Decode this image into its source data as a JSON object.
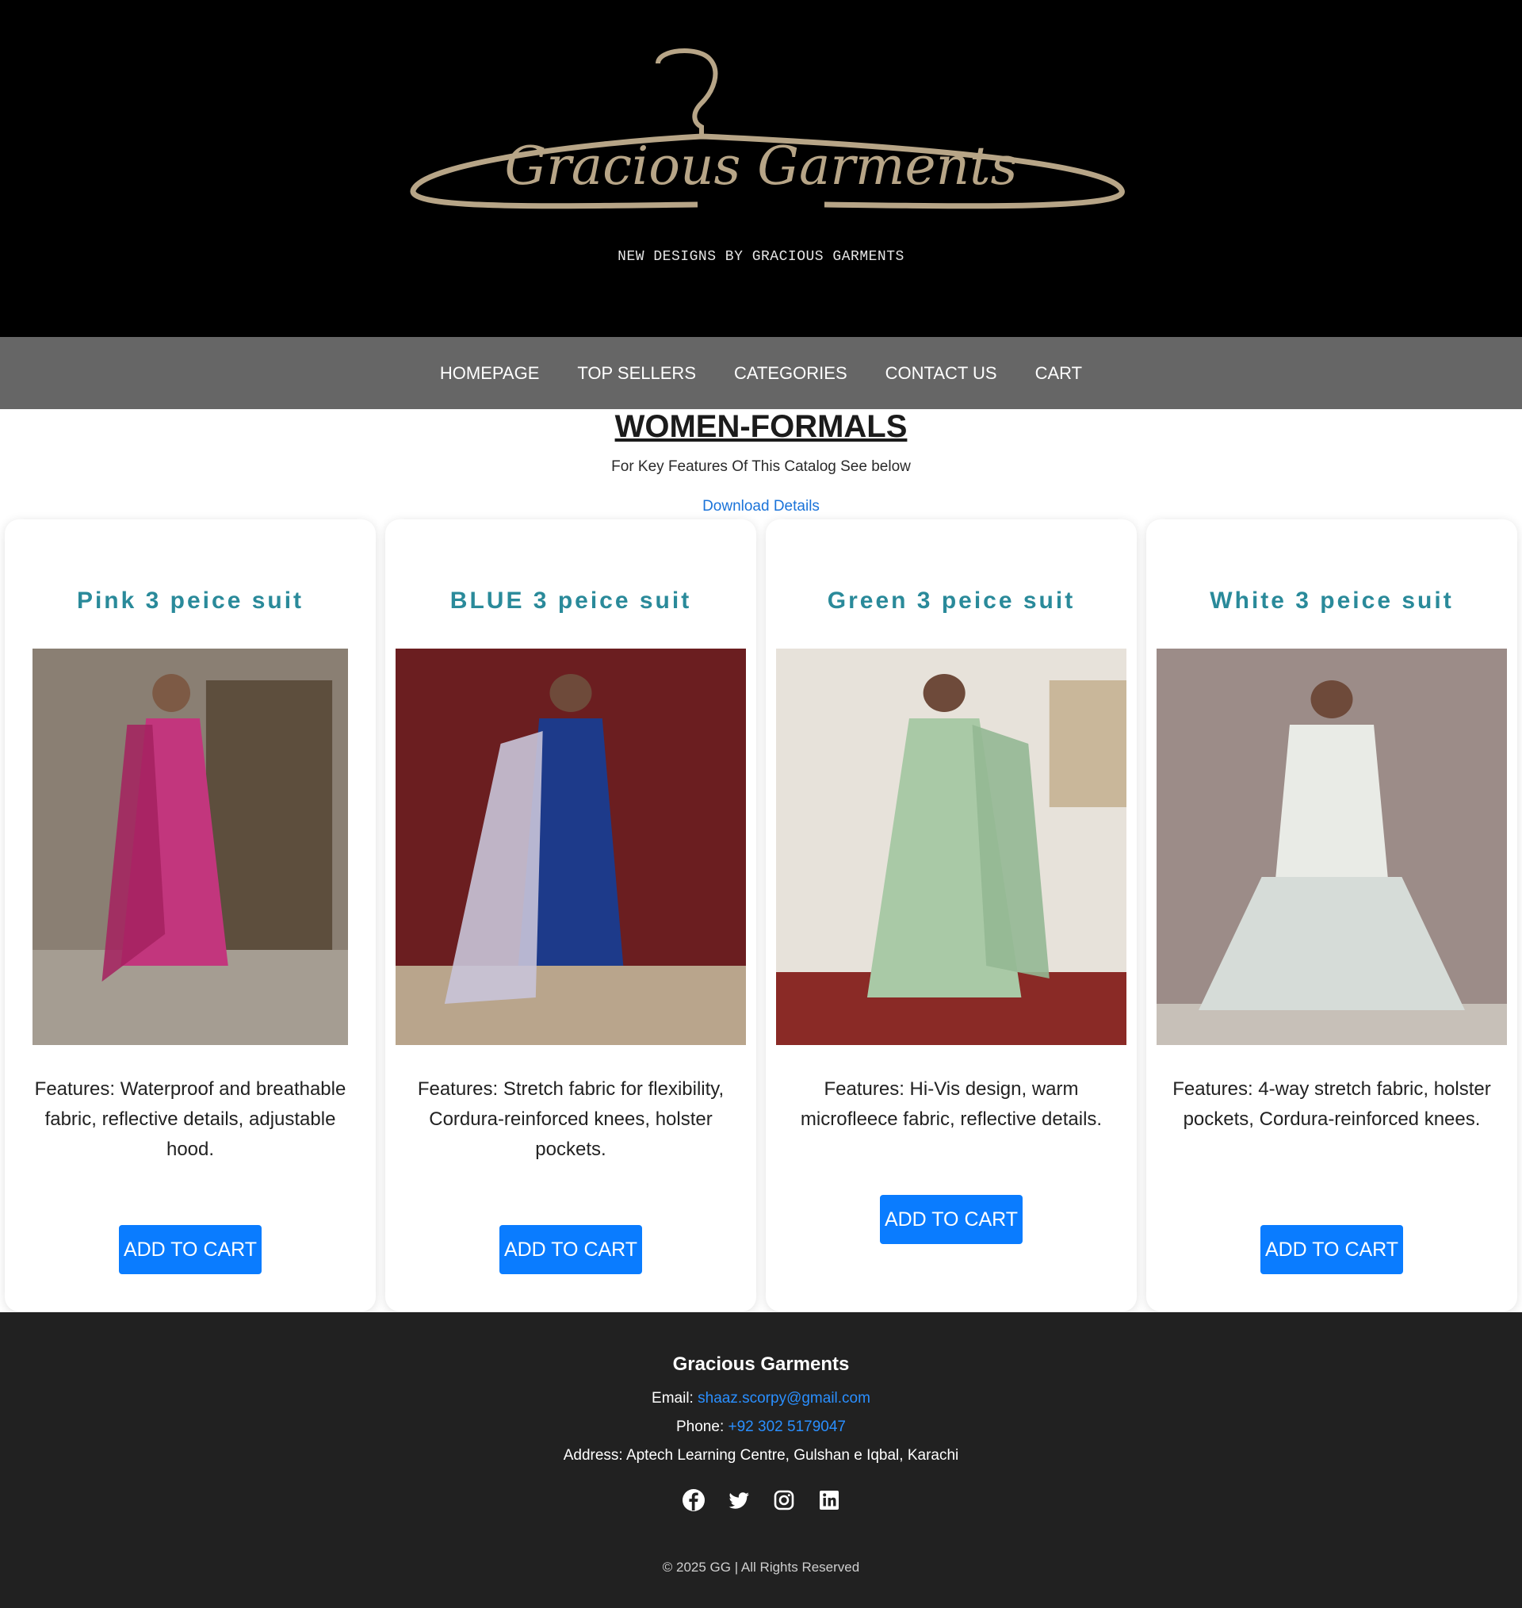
{
  "header": {
    "logo_text": "Gracious Garments",
    "tagline": "NEW DESIGNS BY GRACIOUS GARMENTS"
  },
  "nav": {
    "items": [
      "HOMEPAGE",
      "TOP SELLERS",
      "CATEGORIES",
      "CONTACT US",
      "CART"
    ]
  },
  "main": {
    "title": "WOMEN-FORMALS",
    "subtitle": "For Key Features Of This Catalog See below",
    "download_label": "Download Details"
  },
  "products": [
    {
      "title": "Pink 3 peice suit",
      "features": "Features: Waterproof and breathable fabric, reflective details, adjustable hood.",
      "button": "ADD TO CART",
      "accent": "#c2367d"
    },
    {
      "title": "BLUE 3 peice suit",
      "features": "Features: Stretch fabric for flexibility, Cordura-reinforced knees, holster pockets.",
      "button": "ADD TO CART",
      "accent": "#1d3a8a"
    },
    {
      "title": "Green 3 peice suit",
      "features": "Features: Hi-Vis design, warm microfleece fabric, reflective details.",
      "button": "ADD TO CART",
      "accent": "#a9c9a6"
    },
    {
      "title": "White 3 peice suit",
      "features": "Features: 4-way stretch fabric, holster pockets, Cordura-reinforced knees.",
      "button": "ADD TO CART",
      "accent": "#e9ebe6"
    }
  ],
  "footer": {
    "brand": "Gracious Garments",
    "email_label": "Email:",
    "email": "shaaz.scorpy@gmail.com",
    "phone_label": "Phone:",
    "phone": "+92 302 5179047",
    "address": "Address: Aptech Learning Centre, Gulshan e Iqbal, Karachi",
    "socials": [
      "facebook-icon",
      "twitter-icon",
      "instagram-icon",
      "linkedin-icon"
    ],
    "copyright": "© 2025 GG | All Rights Reserved"
  },
  "colors": {
    "accent_blue": "#0a7cff",
    "title_teal": "#2a8a9a",
    "nav_gray": "#666666",
    "footer_bg": "#212121"
  }
}
